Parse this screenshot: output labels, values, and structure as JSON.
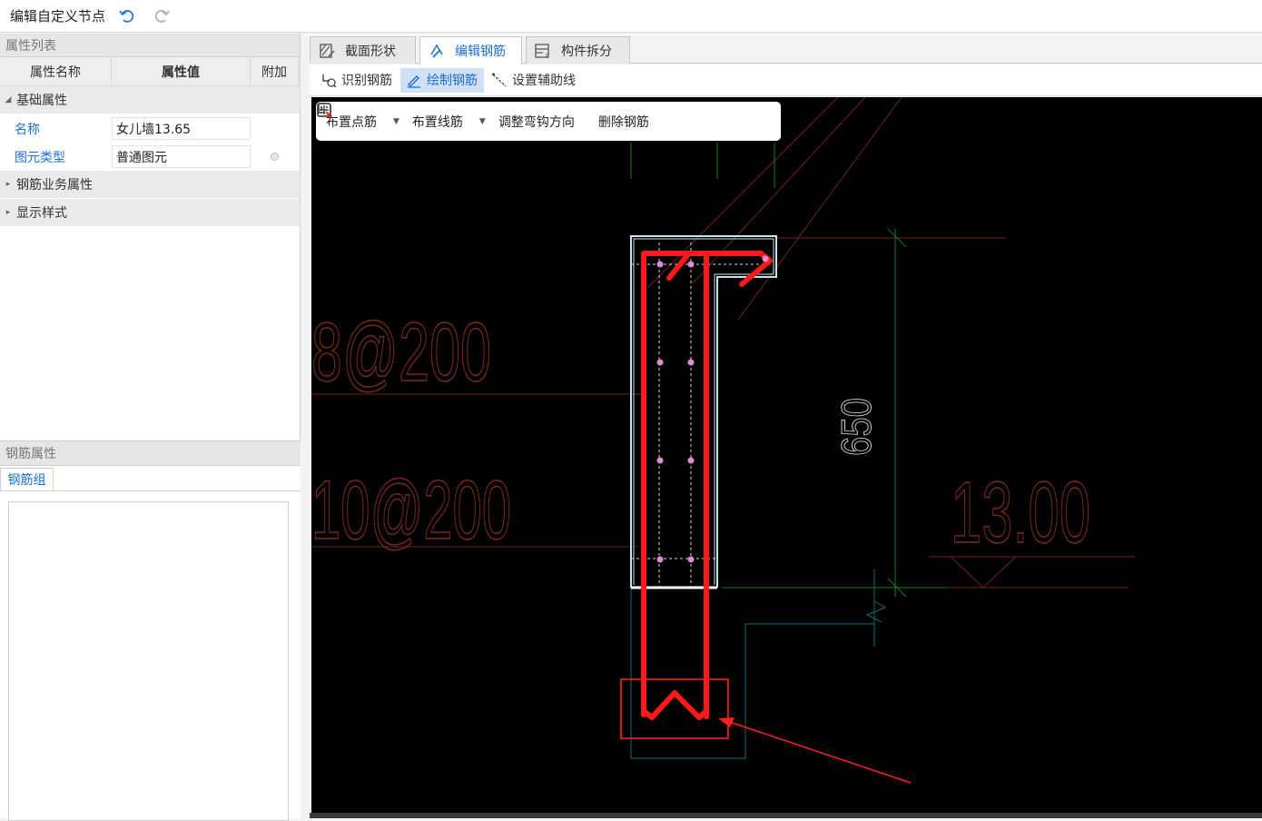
{
  "titlebar": {
    "title": "编辑自定义节点"
  },
  "property_panel": {
    "header": "属性列表",
    "columns": [
      "属性名称",
      "属性值",
      "附加"
    ],
    "groups": {
      "basic": "基础属性",
      "rebar_business": "钢筋业务属性",
      "display_style": "显示样式"
    },
    "rows": [
      {
        "name": "名称",
        "value": "女儿墙13.65"
      },
      {
        "name": "图元类型",
        "value": "普通图元"
      }
    ]
  },
  "rebar_panel": {
    "header": "钢筋属性",
    "tab": "钢筋组"
  },
  "tabs": [
    {
      "label": "截面形状",
      "active": false
    },
    {
      "label": "编辑钢筋",
      "active": true
    },
    {
      "label": "构件拆分",
      "active": false
    }
  ],
  "toolbar": {
    "identify": "识别钢筋",
    "draw": "绘制钢筋",
    "guide": "设置辅助线"
  },
  "float_toolbar": {
    "point_rebar": "布置点筋",
    "line_rebar": "布置线筋",
    "hook_direction": "调整弯钩方向",
    "delete_rebar": "删除钢筋"
  },
  "drawing": {
    "label_top": "8@200",
    "label_bottom": "10@200",
    "dimension": "650",
    "elevation": "13.00"
  },
  "colors": {
    "canvas_bg": "#000000",
    "rebar": "#ff1a1a",
    "outline": "#bfe6f0",
    "annotation": "#7a2a22",
    "accent": "#1a6fd0"
  }
}
